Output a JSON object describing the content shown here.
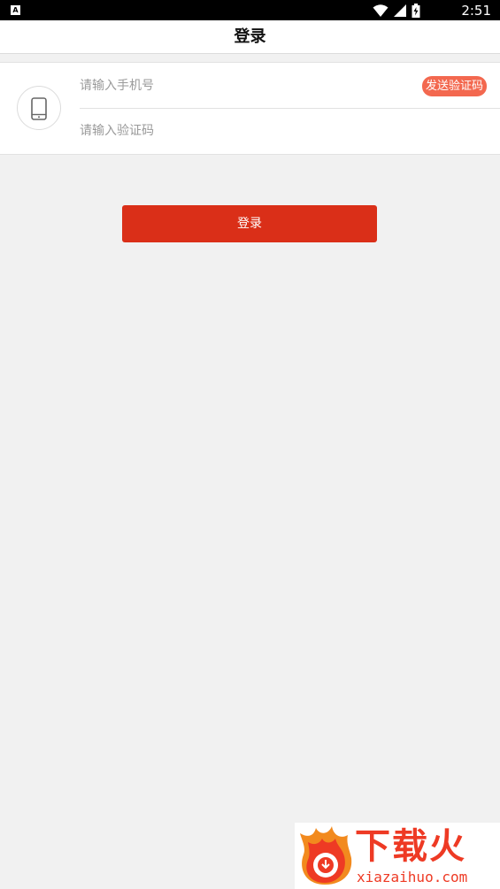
{
  "status_bar": {
    "app_icon_letter": "A",
    "time": "2:51"
  },
  "header": {
    "title": "登录"
  },
  "form": {
    "phone_placeholder": "请输入手机号",
    "code_placeholder": "请输入验证码",
    "send_code_label": "发送验证码"
  },
  "login_button_label": "登录",
  "watermark": {
    "brand": "下载火",
    "url": "xiazaihuo.com"
  },
  "colors": {
    "accent": "#da2f18",
    "send_code": "#f3684f",
    "background": "#f1f1f1"
  },
  "icons": {
    "avatar": "phone-icon",
    "status": [
      "wifi-icon",
      "signal-icon",
      "battery-icon"
    ]
  }
}
